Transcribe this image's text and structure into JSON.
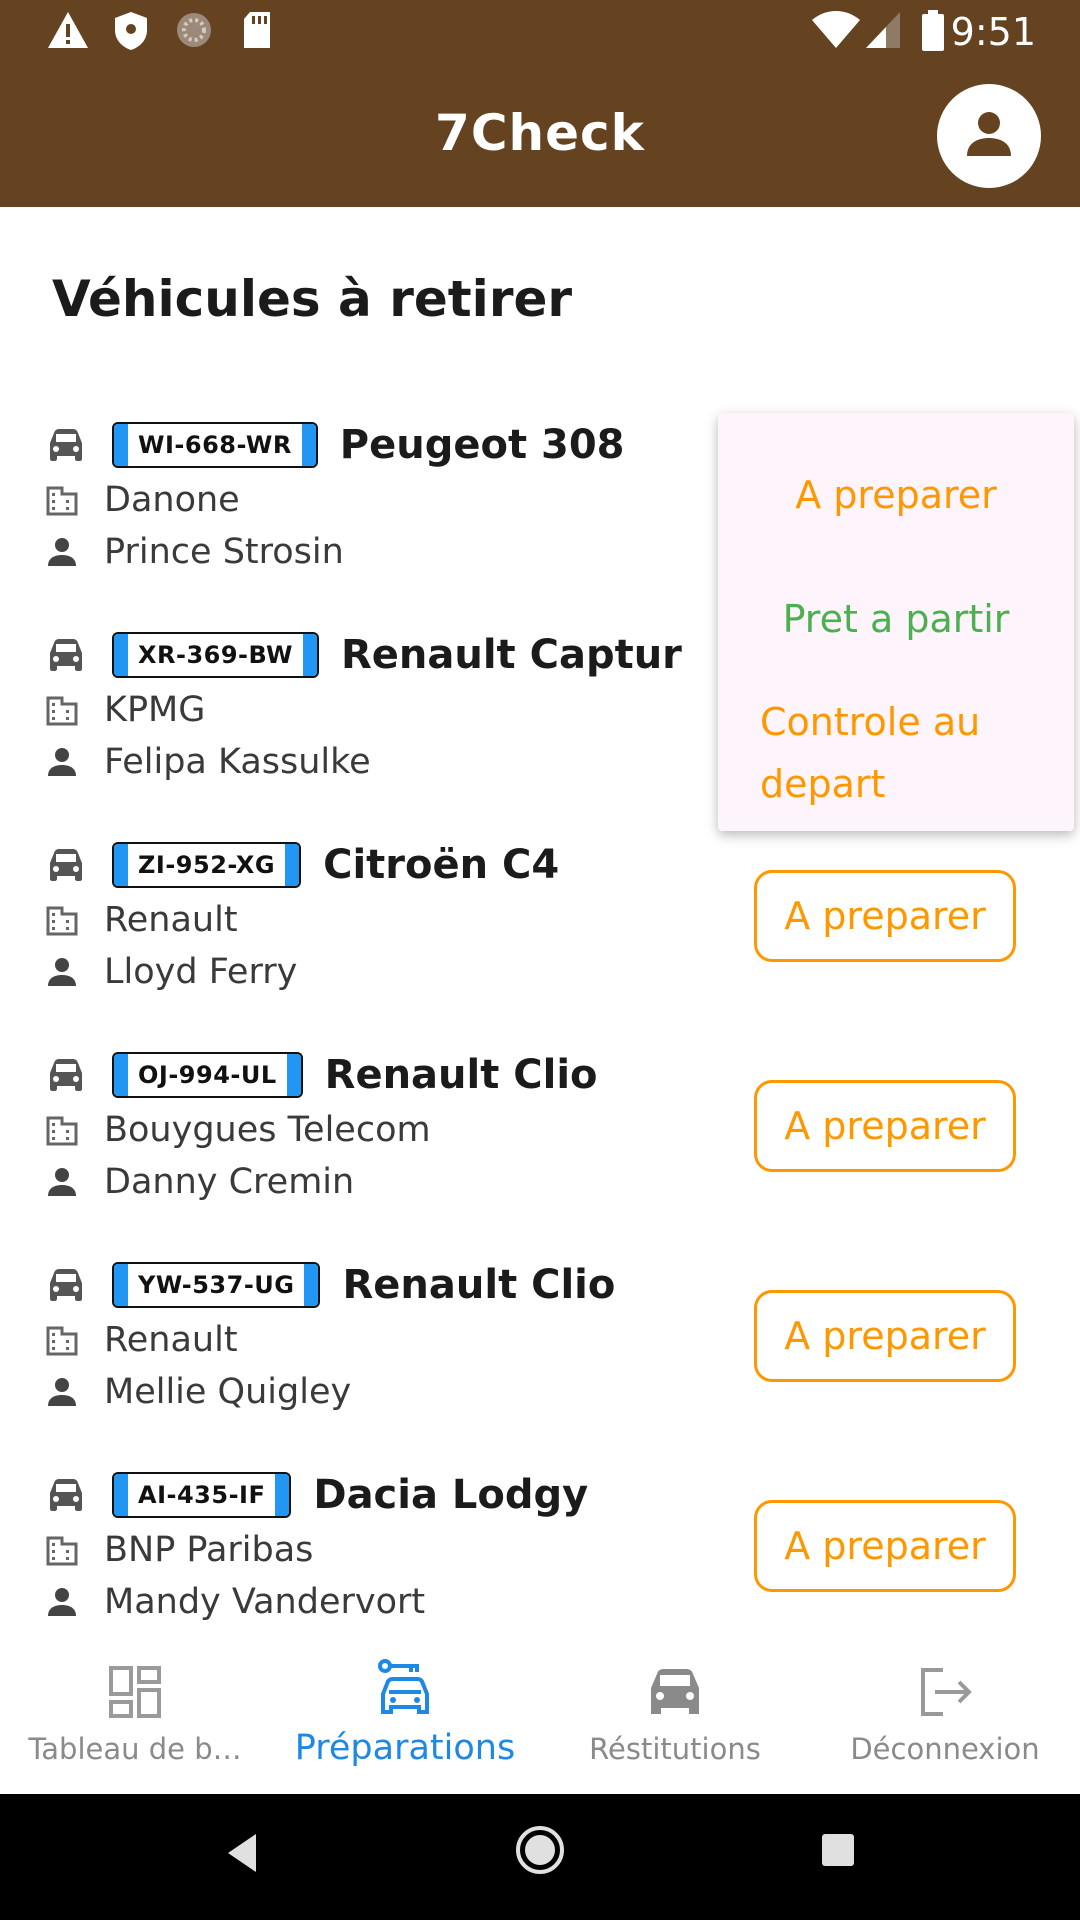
{
  "status_bar": {
    "time": "9:51",
    "icons": [
      "warning-icon",
      "shield-icon",
      "spinner-icon",
      "sd-card-icon",
      "wifi-icon",
      "signal-icon",
      "battery-icon"
    ]
  },
  "app_bar": {
    "title": "7Check",
    "avatar_icon": "person-icon",
    "color": "#654321"
  },
  "page": {
    "title": "Véhicules à retirer"
  },
  "vehicles": [
    {
      "plate": "WI-668-WR",
      "model": "Peugeot 308",
      "company": "Danone",
      "contact": "Prince Strosin",
      "status": "A preparer"
    },
    {
      "plate": "XR-369-BW",
      "model": "Renault Captur",
      "company": "KPMG",
      "contact": "Felipa Kassulke",
      "status": "A preparer"
    },
    {
      "plate": "ZI-952-XG",
      "model": "Citroën C4",
      "company": "Renault",
      "contact": "Lloyd Ferry",
      "status": "A preparer"
    },
    {
      "plate": "OJ-994-UL",
      "model": "Renault Clio",
      "company": "Bouygues Telecom",
      "contact": "Danny Cremin",
      "status": "A preparer"
    },
    {
      "plate": "YW-537-UG",
      "model": "Renault Clio",
      "company": "Renault",
      "contact": "Mellie Quigley",
      "status": "A preparer"
    },
    {
      "plate": "AI-435-IF",
      "model": "Dacia Lodgy",
      "company": "BNP Paribas",
      "contact": "Mandy Vandervort",
      "status": "A preparer"
    }
  ],
  "status_menu": {
    "options": [
      "A preparer",
      "Pret a partir",
      "Controle au depart"
    ],
    "colors": {
      "pending": "#ff9800",
      "ready": "#4caf50"
    }
  },
  "bottom_nav": {
    "items": [
      {
        "label": "Tableau de b…",
        "icon": "dashboard-icon",
        "active": false
      },
      {
        "label": "Préparations",
        "icon": "car-key-icon",
        "active": true
      },
      {
        "label": "Réstitutions",
        "icon": "car-icon",
        "active": false
      },
      {
        "label": "Déconnexion",
        "icon": "logout-icon",
        "active": false
      }
    ],
    "active_color": "#1e88e5"
  }
}
